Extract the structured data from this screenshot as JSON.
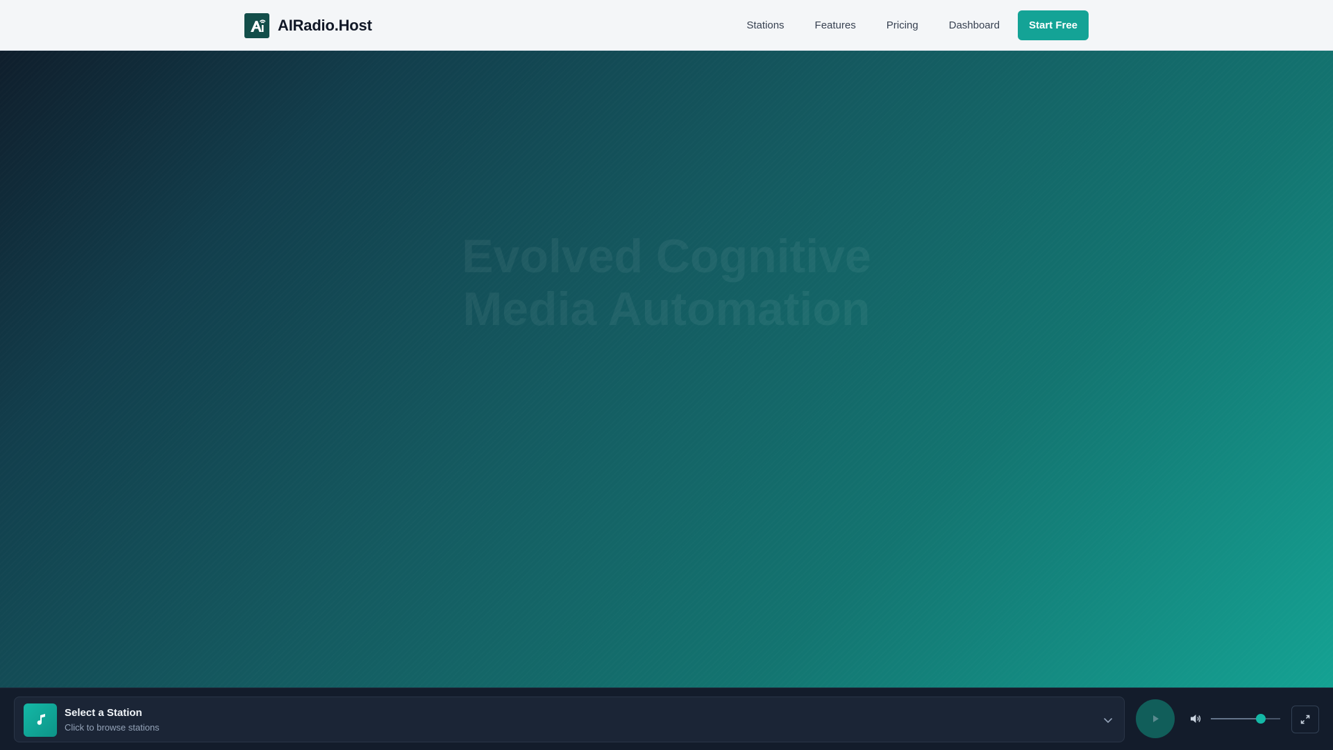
{
  "header": {
    "brand": "AIRadio.Host",
    "nav": [
      "Stations",
      "Features",
      "Pricing",
      "Dashboard"
    ],
    "cta": "Start Free"
  },
  "hero": {
    "title_line1": "Evolved Cognitive",
    "title_line2": "Media Automation"
  },
  "player": {
    "station_title": "Select a Station",
    "station_subtitle": "Click to browse stations",
    "volume_percent": 72
  },
  "icons": {
    "logo": "brand-logo-icon",
    "music": "music-note-icon",
    "chevron": "chevron-down-icon",
    "play": "play-icon",
    "volume": "volume-icon",
    "expand": "expand-icon"
  },
  "colors": {
    "accent": "#14a396",
    "header_bg": "#f4f6f8",
    "player_bg": "#131c2b"
  }
}
